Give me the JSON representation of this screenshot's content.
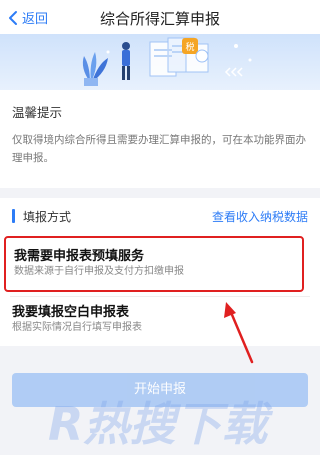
{
  "navbar": {
    "back_label": "返回",
    "title": "综合所得汇算申报"
  },
  "tips": {
    "title": "温馨提示",
    "text": "仅取得境内综合所得且需要办理汇算申报的，可在本功能界面办理申报。"
  },
  "section": {
    "title": "填报方式",
    "link": "查看收入纳税数据"
  },
  "options": [
    {
      "title": "我需要申报表预填服务",
      "subtitle": "数据来源于自行申报及支付方扣缴申报",
      "highlighted": true
    },
    {
      "title": "我要填报空白申报表",
      "subtitle": "根据实际情况自行填写申报表",
      "highlighted": false
    }
  ],
  "start_button": {
    "label": "开始申报",
    "state": "disabled"
  },
  "watermark": {
    "text": "R热搜下载"
  },
  "colors": {
    "accent": "#2d7cf6",
    "highlight_border": "#e02020",
    "button_disabled": "#a9c8f4"
  }
}
